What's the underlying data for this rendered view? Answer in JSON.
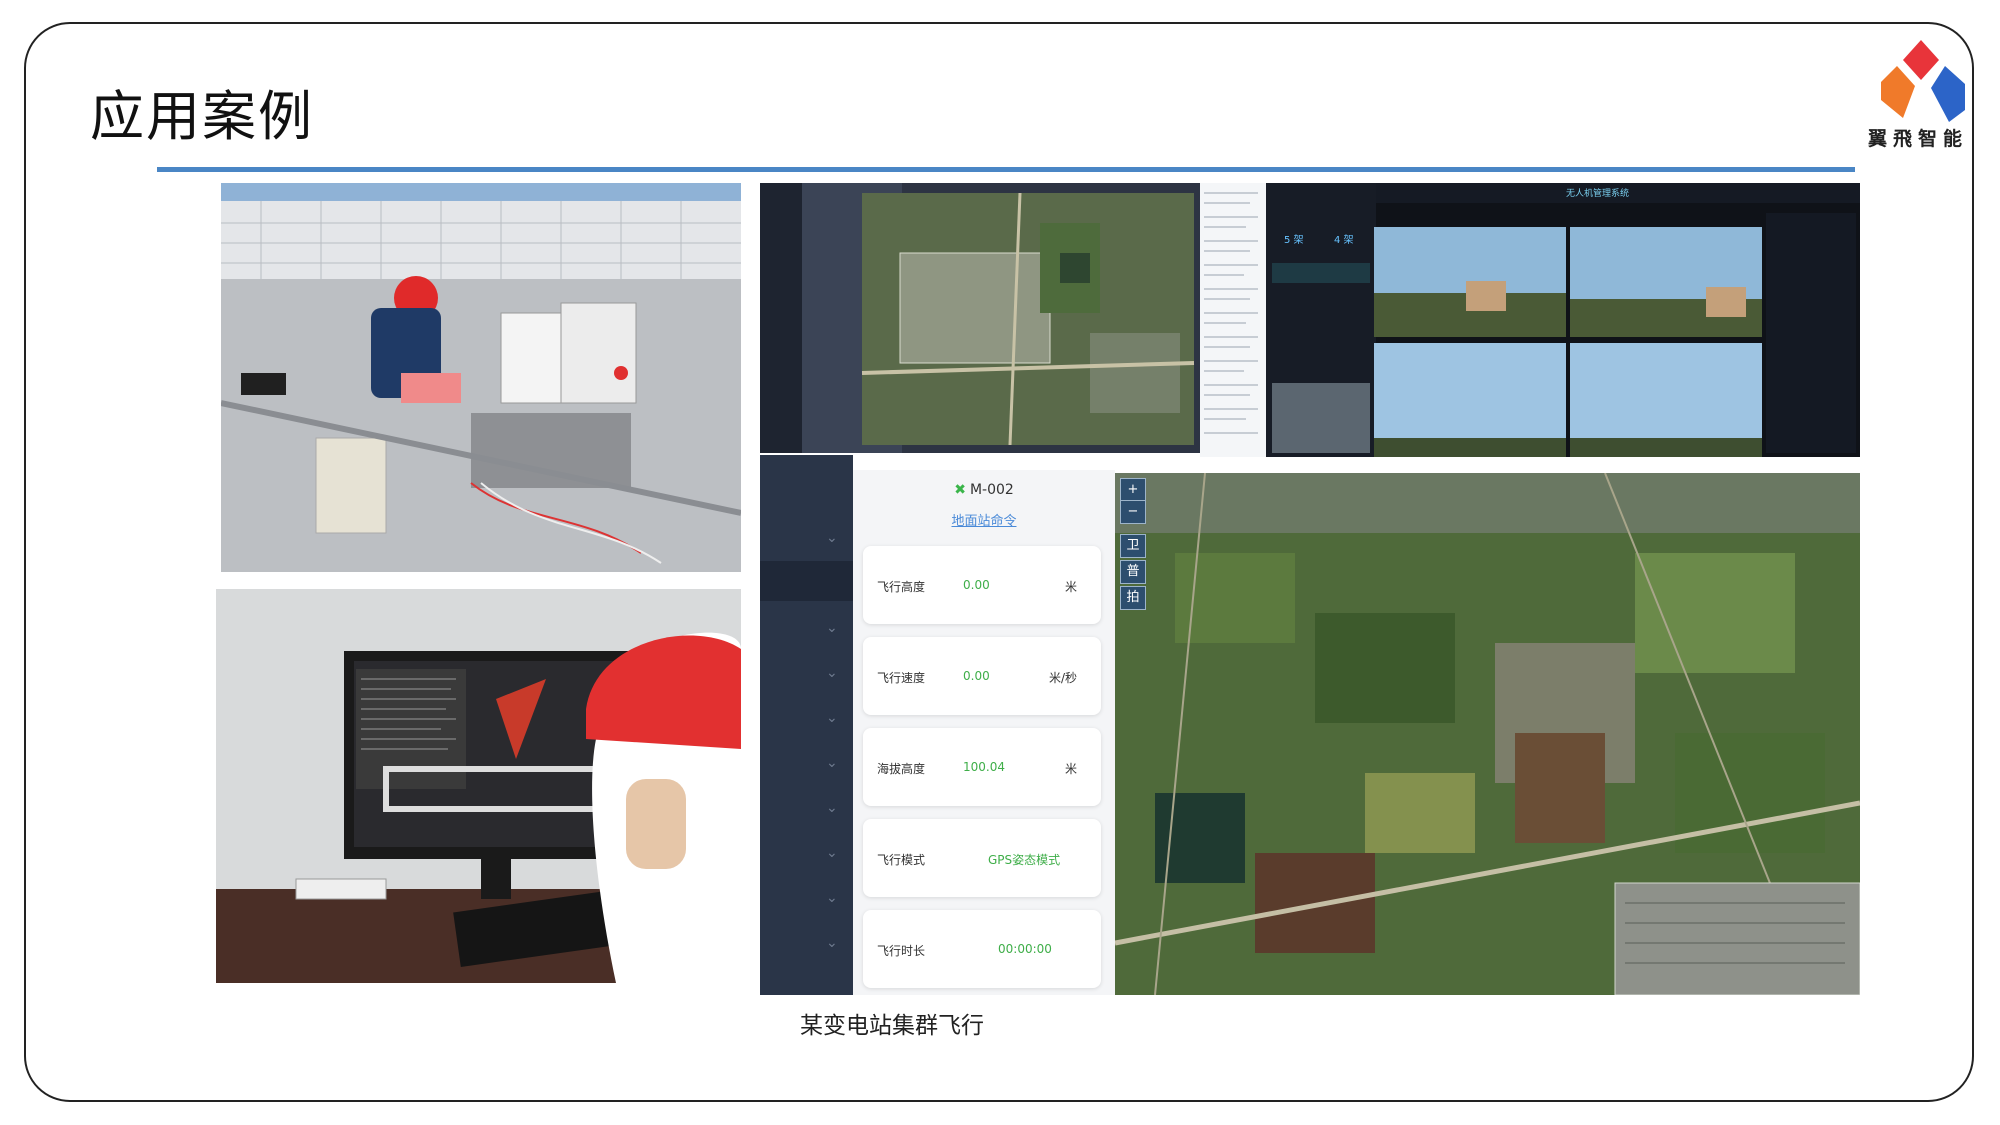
{
  "slide": {
    "title": "应用案例",
    "logo_text": "翼飛智能",
    "caption": "某变电站集群飞行"
  },
  "monitor_screen": {
    "title": "无人机管理系统",
    "count_a": "5 架",
    "count_b": "4 架"
  },
  "flight_panel": {
    "drone_id": "M-002",
    "drone_icon": "drone-icon",
    "link": "地面站命令",
    "rows": [
      {
        "label": "飞行高度",
        "value": "0.00",
        "unit": "米"
      },
      {
        "label": "飞行速度",
        "value": "0.00",
        "unit": "米/秒"
      },
      {
        "label": "海拔高度",
        "value": "100.04",
        "unit": "米"
      },
      {
        "label": "飞行模式",
        "value": "GPS姿态模式",
        "unit": ""
      },
      {
        "label": "飞行时长",
        "value": "00:00:00",
        "unit": ""
      }
    ],
    "map_controls": [
      "+",
      "−",
      "卫",
      "普",
      "拍"
    ]
  },
  "colors": {
    "rule": "#4a86c5",
    "logo_red": "#e8343a",
    "logo_orange": "#f07a2a",
    "logo_blue": "#2c64c8",
    "value_green": "#3fae49"
  }
}
